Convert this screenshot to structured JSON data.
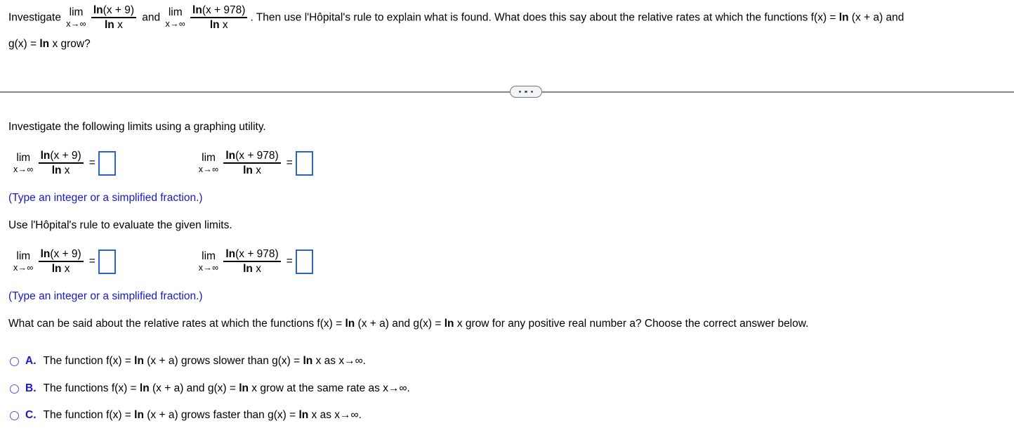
{
  "header": {
    "lead": "Investigate",
    "lim_op": "lim",
    "lim_sub": "x→∞",
    "frac1_num_ln": "ln",
    "frac1_num_arg": "(x + 9)",
    "frac1_den_ln": "ln",
    "frac1_den_arg": "x",
    "conjunction": "and",
    "frac2_num_ln": "ln",
    "frac2_num_arg": "(x + 978)",
    "frac2_den_ln": "ln",
    "frac2_den_arg": "x",
    "tail": ". Then use l'Hôpital's rule to explain what is found. What does this say about the relative rates at which the functions f(x) = ",
    "tail_ln": "ln",
    "tail_rest": " (x + a) and",
    "line2_gx": "g(x) = ",
    "line2_ln": "ln",
    "line2_rest": " x grow?"
  },
  "divider": {
    "expand_button_label": "•••"
  },
  "section1": {
    "prompt": "Investigate the following limits using a graphing utility.",
    "hint": "(Type an integer or a simplified fraction.)",
    "limits": [
      {
        "lim_op": "lim",
        "lim_sub": "x→∞",
        "num_ln": "ln",
        "num_arg": "(x + 9)",
        "den_ln": "ln",
        "den_arg": "x",
        "equals": "=",
        "answer_value": ""
      },
      {
        "lim_op": "lim",
        "lim_sub": "x→∞",
        "num_ln": "ln",
        "num_arg": "(x + 978)",
        "den_ln": "ln",
        "den_arg": "x",
        "equals": "=",
        "answer_value": ""
      }
    ]
  },
  "section2": {
    "prompt": "Use l'Hôpital's rule to evaluate the given limits.",
    "hint": "(Type an integer or a simplified fraction.)",
    "limits": [
      {
        "lim_op": "lim",
        "lim_sub": "x→∞",
        "num_ln": "ln",
        "num_arg": "(x + 9)",
        "den_ln": "ln",
        "den_arg": "x",
        "equals": "=",
        "answer_value": ""
      },
      {
        "lim_op": "lim",
        "lim_sub": "x→∞",
        "num_ln": "ln",
        "num_arg": "(x + 978)",
        "den_ln": "ln",
        "den_arg": "x",
        "equals": "=",
        "answer_value": ""
      }
    ]
  },
  "question": {
    "part1": "What can be said about the relative rates at which the functions f(x) = ",
    "ln1": "ln",
    "part2": " (x + a) and g(x) = ",
    "ln2": "ln",
    "part3": " x grow for any positive real number a? Choose the correct answer below."
  },
  "choices": [
    {
      "letter": "A.",
      "part1": "The function f(x) = ",
      "ln1": "ln",
      "part2": " (x + a) grows slower than g(x) = ",
      "ln2": "ln",
      "part3": " x as x→∞.",
      "selected": false
    },
    {
      "letter": "B.",
      "part1": "The functions f(x) = ",
      "ln1": "ln",
      "part2": " (x + a) and g(x) = ",
      "ln2": "ln",
      "part3": " x grow at the same rate as x→∞.",
      "selected": false
    },
    {
      "letter": "C.",
      "part1": "The function f(x) = ",
      "ln1": "ln",
      "part2": " (x + a) grows faster than g(x) = ",
      "ln2": "ln",
      "part3": " x as x→∞.",
      "selected": false
    }
  ],
  "colors": {
    "accent_blue": "#1a18c8",
    "input_border": "#2a64c8",
    "divider_gray": "#818b95"
  }
}
